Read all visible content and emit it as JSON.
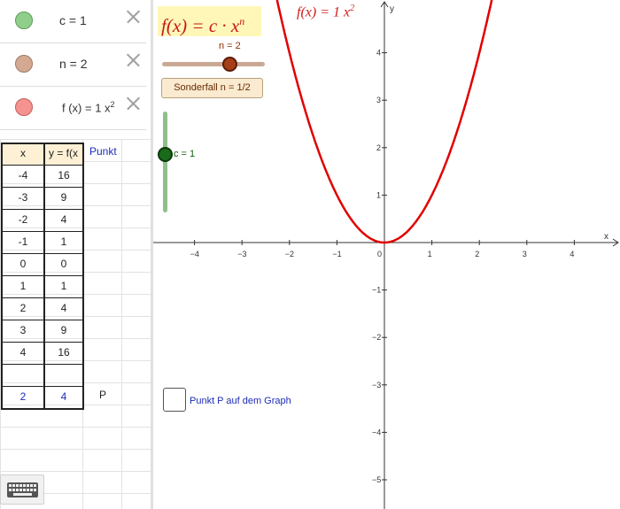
{
  "algebra": {
    "items": [
      {
        "label": "c = 1",
        "color": "#8fcf8b"
      },
      {
        "label": "n = 2",
        "color": "#d3a992"
      },
      {
        "label_main": "f (x)  =  1 x",
        "label_exp": "2",
        "color": "#f49390"
      }
    ]
  },
  "spreadsheet": {
    "headers": [
      "x",
      "y = f(x",
      "Punkt"
    ],
    "rows": [
      [
        "-4",
        "16"
      ],
      [
        "-3",
        "9"
      ],
      [
        "-2",
        "4"
      ],
      [
        "-1",
        "1"
      ],
      [
        "0",
        "0"
      ],
      [
        "1",
        "1"
      ],
      [
        "2",
        "4"
      ],
      [
        "3",
        "9"
      ],
      [
        "4",
        "16"
      ],
      [
        "",
        ""
      ]
    ],
    "point_row": [
      "2",
      "4"
    ],
    "point_name": "P"
  },
  "graphics": {
    "formula_main": "f(x) = c · x",
    "formula_exp": "n",
    "function_label_main": "f(x)  =  1 x",
    "function_label_exp": "2",
    "n_slider_label": "n = 2",
    "n_value": 2,
    "c_slider_label": "c = 1",
    "c_value": 1,
    "button_label": "Sonderfall n = 1/2",
    "checkbox_label": "Punkt P auf dem Graph",
    "checkbox_checked": false,
    "x_axis_label": "x",
    "y_axis_label": "y",
    "x_ticks": [
      "−4",
      "−3",
      "−2",
      "−1",
      "0",
      "1",
      "2",
      "3",
      "4"
    ],
    "y_ticks": [
      "4",
      "3",
      "2",
      "1",
      "−1",
      "−2",
      "−3",
      "−4",
      "−5"
    ],
    "curve_color": "#e10000"
  }
}
